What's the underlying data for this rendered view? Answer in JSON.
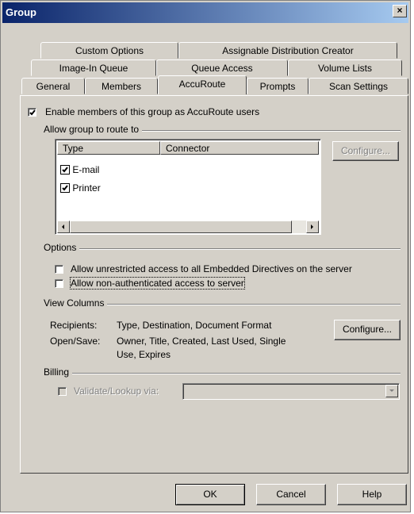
{
  "window": {
    "title": "Group",
    "close_glyph": "×"
  },
  "tabs": {
    "row1": [
      "Custom Options",
      "Assignable Distribution Creator"
    ],
    "row2": [
      "Image-In Queue",
      "Queue Access",
      "Volume Lists"
    ],
    "row3": [
      "General",
      "Members",
      "AccuRoute",
      "Prompts",
      "Scan Settings"
    ],
    "active": "AccuRoute"
  },
  "enable": {
    "label": "Enable members of this group as AccuRoute users",
    "checked": true
  },
  "route": {
    "group_label": "Allow group to route to",
    "columns": [
      "Type",
      "Connector"
    ],
    "items": [
      {
        "label": "E-mail",
        "checked": true
      },
      {
        "label": "Printer",
        "checked": true
      }
    ],
    "configure_label": "Configure...",
    "configure_enabled": false
  },
  "options": {
    "group_label": "Options",
    "items": [
      {
        "label": "Allow unrestricted access to all Embedded Directives on the server",
        "checked": false
      },
      {
        "label": "Allow non-authenticated access to server",
        "checked": false
      }
    ]
  },
  "view_columns": {
    "group_label": "View Columns",
    "recipients_key": "Recipients:",
    "recipients_value": "Type, Destination, Document Format",
    "opensave_key": "Open/Save:",
    "opensave_value_line1": "Owner, Title, Created, Last Used, Single",
    "opensave_value_line2": "Use, Expires",
    "configure_label": "Configure..."
  },
  "billing": {
    "group_label": "Billing",
    "validate_label": "Validate/Lookup via:",
    "validate_checked": false,
    "select_value": ""
  },
  "footer": {
    "ok": "OK",
    "cancel": "Cancel",
    "help": "Help"
  }
}
